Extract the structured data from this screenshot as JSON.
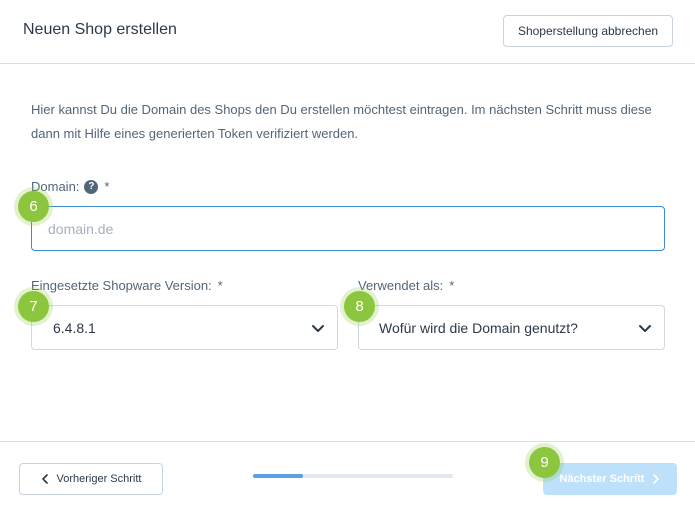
{
  "header": {
    "title": "Neuen Shop erstellen",
    "cancel_label": "Shoperstellung abbrechen"
  },
  "intro_text": "Hier kannst Du die Domain des Shops den Du erstellen möchtest eintragen. Im nächsten Schritt muss diese dann mit Hilfe eines generierten Token verifiziert werden.",
  "domain": {
    "label": "Domain:",
    "help_icon": "question-circle-icon",
    "help_glyph": "?",
    "required_mark": "*",
    "placeholder": "domain.de",
    "value": ""
  },
  "version": {
    "label": "Eingesetzte Shopware Version:",
    "required_mark": "*",
    "selected": "6.4.8.1"
  },
  "usage": {
    "label": "Verwendet als:",
    "required_mark": "*",
    "selected": "Wofür wird die Domain genutzt?"
  },
  "step_badges": [
    "6",
    "7",
    "8",
    "9"
  ],
  "footer": {
    "prev_label": "Vorheriger Schritt",
    "next_label": "Nächster Schritt",
    "progress_fraction": 0.25
  },
  "colors": {
    "accent": "#3d8bd0",
    "badge": "#8cc63f",
    "next_disabled_bg": "#bde0fb"
  }
}
